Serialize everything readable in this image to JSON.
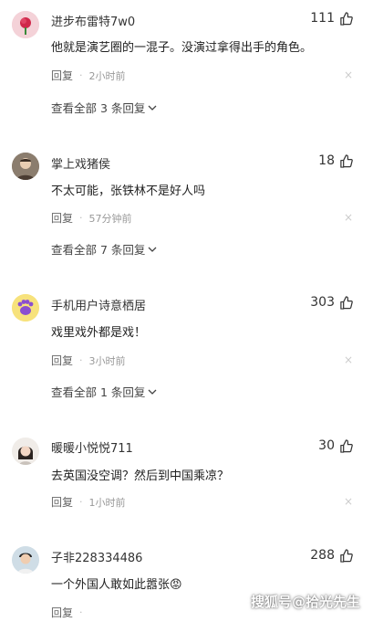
{
  "comments": [
    {
      "username": "进步布雷特7w0",
      "likes": "111",
      "text": "他就是演艺圈的一混子。没演过拿得出手的角色。",
      "reply_label": "回复",
      "time": "2小时前",
      "view_all": "查看全部 3 条回复",
      "avatar_icon": "rose-avatar-icon"
    },
    {
      "username": "掌上戏猪侯",
      "likes": "18",
      "text": "不太可能，张铁林不是好人吗",
      "reply_label": "回复",
      "time": "57分钟前",
      "view_all": "查看全部 7 条回复",
      "avatar_icon": "person-avatar-icon"
    },
    {
      "username": "手机用户诗意栖居",
      "likes": "303",
      "text": "戏里戏外都是戏！",
      "reply_label": "回复",
      "time": "3小时前",
      "view_all": "查看全部 1 条回复",
      "avatar_icon": "paw-avatar-icon"
    },
    {
      "username": "暖暖小悦悦711",
      "likes": "30",
      "text": "去英国没空调？然后到中国乘凉？",
      "reply_label": "回复",
      "time": "1小时前",
      "avatar_icon": "girl-avatar-icon"
    },
    {
      "username": "子非228334486",
      "likes": "288",
      "text": "一个外国人敢如此嚣张😡",
      "reply_label": "回复",
      "time": "",
      "avatar_icon": "man-avatar-icon"
    }
  ],
  "close_symbol": "×",
  "watermark": "搜狐号@拾光先生",
  "colors": {
    "text": "#222222",
    "meta": "#999999",
    "background": "#ffffff"
  }
}
